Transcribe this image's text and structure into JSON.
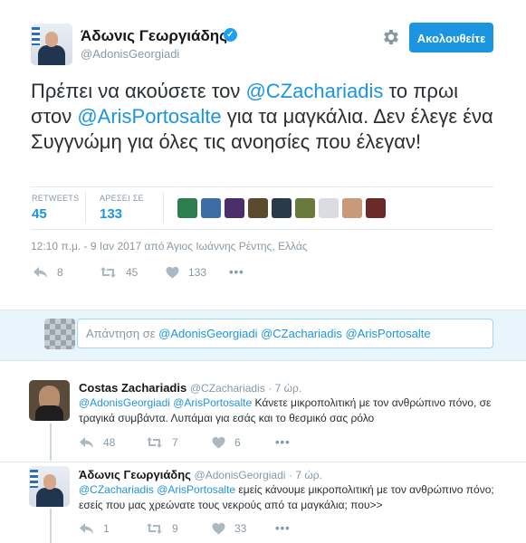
{
  "tweet": {
    "display_name": "Άδωνις Γεωργιάδης",
    "handle": "@AdonisGeorgiadi",
    "verified_mark": "✓",
    "follow_label": "Ακολουθείτε",
    "text_parts": [
      "Πρέπει να ακούσετε τον ",
      "@CZachariadis",
      " το πρωι στον ",
      "@ArisPortosalte",
      " για τα μαγκάλια. Δεν έλεγε ένα Συγγνώμη για όλες τις ανοησίες που έλεγαν!"
    ],
    "retweets_label": "RETWEETS",
    "retweets_count": "45",
    "likes_label": "ΑΡΕΣΕΙ ΣΕ",
    "likes_count": "133",
    "favoriters_colors": [
      "#2e7d4f",
      "#3b6ea5",
      "#4a2f6b",
      "#5b4a2e",
      "#2a3a4a",
      "#6a7a3a",
      "#d9dde1",
      "#c99a7a",
      "#6b2a2a"
    ],
    "timestamp": "12:10 π.μ. - 9 Ιαν 2017 από Άγιος Ιωάννης Ρέντης, Ελλάς",
    "actions": {
      "reply_count": "8",
      "retweet_count": "45",
      "like_count": "133",
      "more": "•••"
    }
  },
  "reply_box": {
    "placeholder": "Απάντηση σε",
    "mentions": "@AdonisGeorgiadi @CZachariadis @ArisPortosalte"
  },
  "replies": [
    {
      "display_name": "Costas Zachariadis",
      "handle": "@CZachariadis",
      "time": "· 7 ώρ.",
      "mentions": "@AdonisGeorgiadi @ArisPortosalte",
      "text": " Κάνετε μικροπολιτική με τον ανθρώπινο πόνο, σε τραγικά συμβάντα. Λυπάμαι για εσάς και το θεσμικό σας ρόλο",
      "reply_count": "48",
      "retweet_count": "7",
      "like_count": "6",
      "more": "•••"
    },
    {
      "display_name": "Άδωνις Γεωργιάδης",
      "handle": "@AdonisGeorgiadi",
      "time": "· 7 ώρ.",
      "mentions": "@CZachariadis @ArisPortosalte",
      "text": " εμείς κάνουμε μικροπολιτική με τον ανθρώπινο πόνο; εσείς που μας χρεώνατε τους νεκρούς από τα μαγκάλια; που>>",
      "reply_count": "1",
      "retweet_count": "9",
      "like_count": "33",
      "more": "•••"
    }
  ]
}
